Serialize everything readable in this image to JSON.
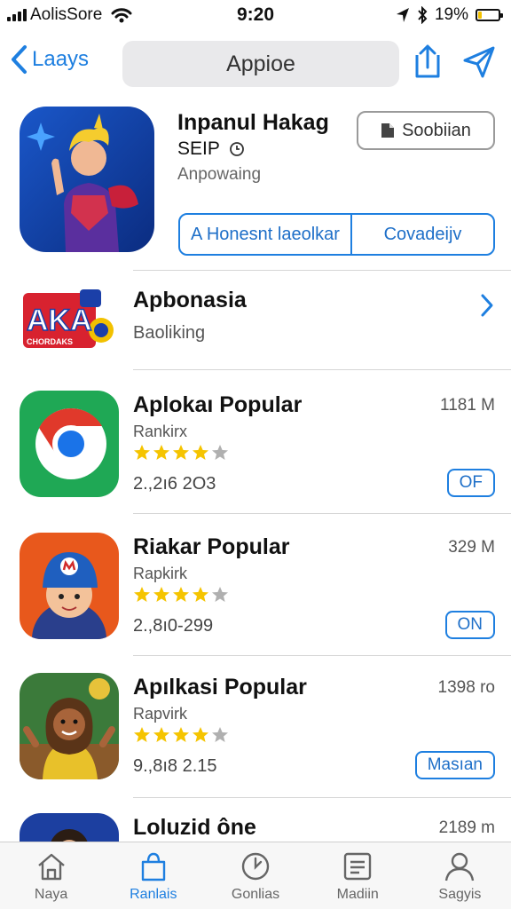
{
  "status": {
    "carrier": "AolisSore",
    "time": "9:20",
    "battery": "19%",
    "battery_level": 0.19
  },
  "nav": {
    "back_label": "Laays",
    "search_text": "Appioe"
  },
  "featured": {
    "title": "Inpanul Hakag",
    "subtitle": "SEIP",
    "status": "Anpowaing",
    "button_label": "Soobiian",
    "segment_left": "A Honesnt laeolkar",
    "segment_right": "Covadeijv"
  },
  "category": {
    "title": "Apbonasia",
    "subtitle": "Baoliking",
    "logo_text": "AKA",
    "logo_small": "CHORDAKS"
  },
  "apps": [
    {
      "name": "Aplokaı Popular",
      "rank": "Rankirx",
      "rating": 4.5,
      "count": "2.,2ı6 2O3",
      "size": "1181 M",
      "button": "OF"
    },
    {
      "name": "Riakar Popular",
      "rank": "Rapkirk",
      "rating": 4.5,
      "count": "2.,8ı0-299",
      "size": "329 M",
      "button": "ON"
    },
    {
      "name": "Apılkasi Popular",
      "rank": "Rapvirk",
      "rating": 4.5,
      "count": "9.,8ı8 2.15",
      "size": "1398 ro",
      "button": "Masıan"
    },
    {
      "name": "Loluzid ône",
      "size": "2189 m"
    }
  ],
  "tabs": [
    {
      "label": "Naya",
      "icon": "home-icon",
      "active": false
    },
    {
      "label": "Ranlais",
      "icon": "bag-icon",
      "active": true
    },
    {
      "label": "Gonlias",
      "icon": "clock-icon",
      "active": false
    },
    {
      "label": "Madiin",
      "icon": "list-icon",
      "active": false
    },
    {
      "label": "Sagyis",
      "icon": "person-icon",
      "active": false
    }
  ],
  "colors": {
    "accent": "#1e7fe0",
    "star": "#f5c400",
    "star_empty": "#b0b0b0"
  }
}
